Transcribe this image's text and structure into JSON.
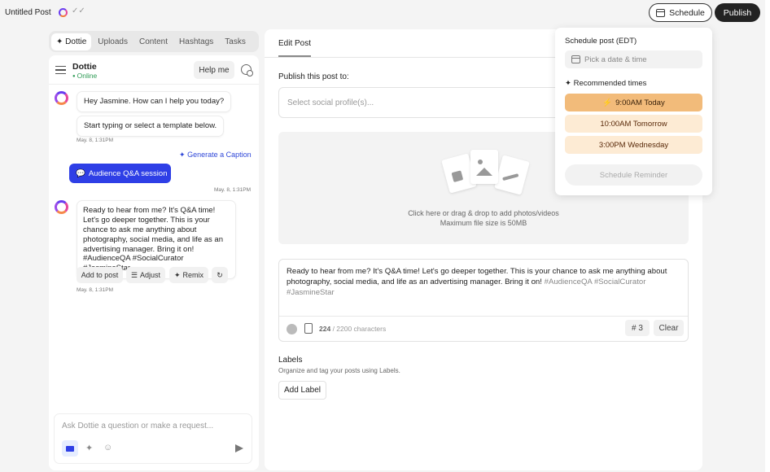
{
  "topbar": {
    "post_title": "Untitled Post",
    "check_glyph": "✓✓",
    "schedule_label": "Schedule",
    "publish_label": "Publish"
  },
  "left_panel": {
    "tabs": [
      {
        "label": "Dottie",
        "icon": "sparkle-icon",
        "active": true
      },
      {
        "label": "Uploads"
      },
      {
        "label": "Content"
      },
      {
        "label": "Hashtags"
      },
      {
        "label": "Tasks"
      }
    ],
    "header": {
      "name": "Dottie",
      "status": "Online",
      "help_label": "Help me"
    },
    "messages": {
      "greeting_1": "Hey Jasmine. How can I help you today?",
      "greeting_2": "Start typing or select a template below.",
      "ts_1": "May. 8, 1:31PM",
      "generate_caption": "Generate a Caption",
      "user_request": "Audience Q&A session",
      "ts_2": "May. 8, 1:31PM",
      "reply": "Ready to hear from me? It's Q&A time! Let's go deeper together. This is your chance to ask me anything about photography, social media, and life as an advertising manager. Bring it on! #AudienceQA #SocialCurator #JasmineStar",
      "ts_3": "May. 8, 1:31PM"
    },
    "actions": {
      "add_to_post": "Add to post",
      "adjust": "Adjust",
      "remix": "Remix"
    },
    "input": {
      "placeholder": "Ask Dottie a question or make a request..."
    }
  },
  "main": {
    "tab_label": "Edit Post",
    "publish_to_label": "Publish this post to:",
    "profile_placeholder": "Select social profile(s)...",
    "dropzone_line1": "Click here or drag & drop to add photos/videos",
    "dropzone_line2": "Maximum file size is 50MB",
    "caption_body": "Ready to hear from me? It's Q&A time! Let's go deeper together. This is your chance to ask me anything about photography, social media, and life as an advertising manager. Bring it on!",
    "caption_hashtags": "#AudienceQA #SocialCurator #JasmineStar",
    "char_count": "224",
    "char_limit": "/ 2200 characters",
    "hashtag_count": "# 3",
    "clear_label": "Clear",
    "labels_title": "Labels",
    "labels_desc": "Organize and tag your posts using Labels.",
    "add_label": "Add Label"
  },
  "schedule_popover": {
    "title": "Schedule post (EDT)",
    "pick_placeholder": "Pick a date & time",
    "recommended_title": "Recommended times",
    "times": [
      {
        "label": "9:00AM Today",
        "primary": true
      },
      {
        "label": "10:00AM Tomorrow"
      },
      {
        "label": "3:00PM Wednesday"
      }
    ],
    "reminder_label": "Schedule Reminder"
  },
  "colors": {
    "accent_blue": "#2e3fe6",
    "online_green": "#2e9b55",
    "time_primary": "#f2bb7a",
    "time_secondary": "#fdebd4"
  }
}
